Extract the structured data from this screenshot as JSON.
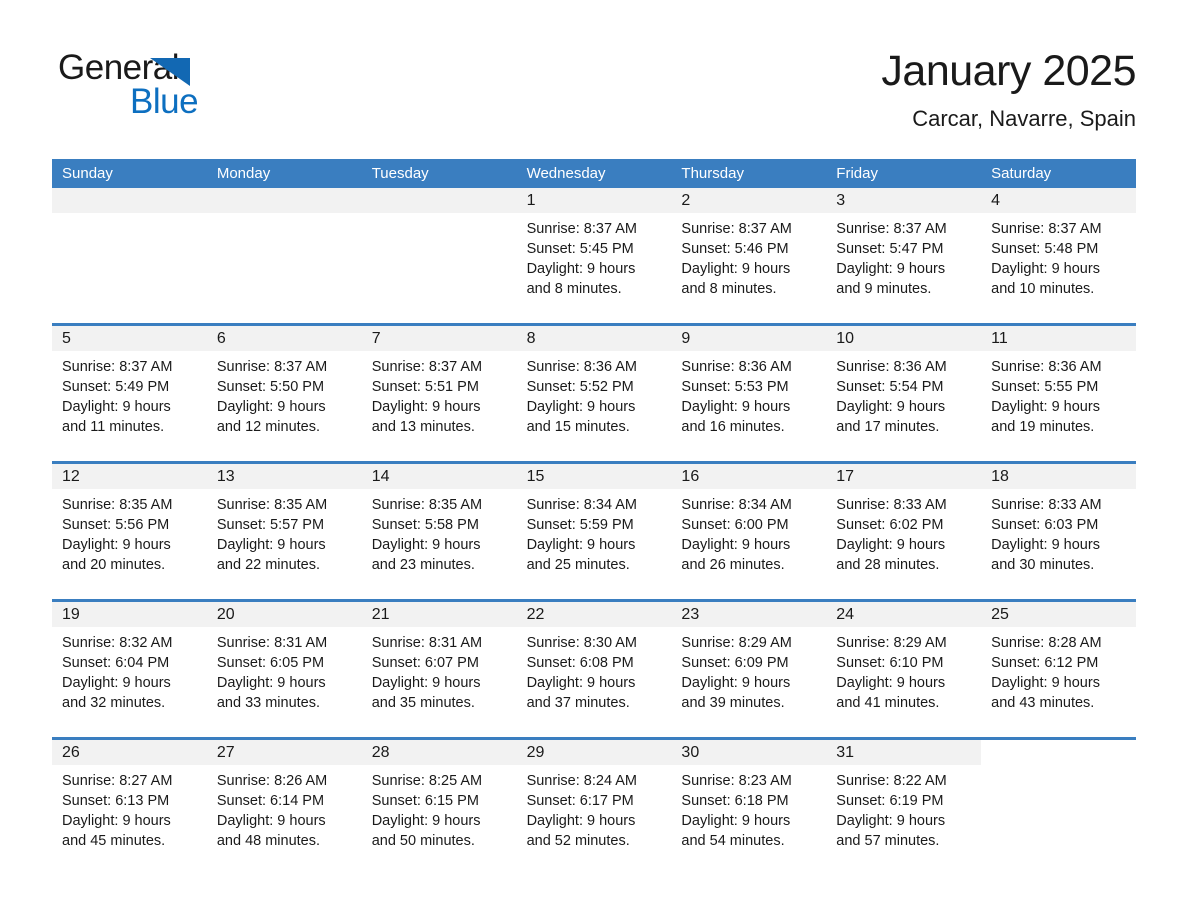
{
  "brand": {
    "name_part1": "General",
    "name_part2": "Blue",
    "accent_color": "#0d6fc0",
    "triangle_color": "#1268b3"
  },
  "header": {
    "title": "January 2025",
    "subtitle": "Carcar, Navarre, Spain"
  },
  "theme": {
    "header_row_bg": "#3a7ec0",
    "week_divider": "#3a7ec0",
    "day_band_bg": "#f2f2f2",
    "text_color": "#1a1a1a"
  },
  "weekdays": [
    "Sunday",
    "Monday",
    "Tuesday",
    "Wednesday",
    "Thursday",
    "Friday",
    "Saturday"
  ],
  "weeks": [
    [
      {
        "day": "",
        "l1": "",
        "l2": "",
        "l3": "",
        "l4": "",
        "empty": true
      },
      {
        "day": "",
        "l1": "",
        "l2": "",
        "l3": "",
        "l4": "",
        "empty": true
      },
      {
        "day": "",
        "l1": "",
        "l2": "",
        "l3": "",
        "l4": "",
        "empty": true
      },
      {
        "day": "1",
        "l1": "Sunrise: 8:37 AM",
        "l2": "Sunset: 5:45 PM",
        "l3": "Daylight: 9 hours",
        "l4": "and 8 minutes."
      },
      {
        "day": "2",
        "l1": "Sunrise: 8:37 AM",
        "l2": "Sunset: 5:46 PM",
        "l3": "Daylight: 9 hours",
        "l4": "and 8 minutes."
      },
      {
        "day": "3",
        "l1": "Sunrise: 8:37 AM",
        "l2": "Sunset: 5:47 PM",
        "l3": "Daylight: 9 hours",
        "l4": "and 9 minutes."
      },
      {
        "day": "4",
        "l1": "Sunrise: 8:37 AM",
        "l2": "Sunset: 5:48 PM",
        "l3": "Daylight: 9 hours",
        "l4": "and 10 minutes."
      }
    ],
    [
      {
        "day": "5",
        "l1": "Sunrise: 8:37 AM",
        "l2": "Sunset: 5:49 PM",
        "l3": "Daylight: 9 hours",
        "l4": "and 11 minutes."
      },
      {
        "day": "6",
        "l1": "Sunrise: 8:37 AM",
        "l2": "Sunset: 5:50 PM",
        "l3": "Daylight: 9 hours",
        "l4": "and 12 minutes."
      },
      {
        "day": "7",
        "l1": "Sunrise: 8:37 AM",
        "l2": "Sunset: 5:51 PM",
        "l3": "Daylight: 9 hours",
        "l4": "and 13 minutes."
      },
      {
        "day": "8",
        "l1": "Sunrise: 8:36 AM",
        "l2": "Sunset: 5:52 PM",
        "l3": "Daylight: 9 hours",
        "l4": "and 15 minutes."
      },
      {
        "day": "9",
        "l1": "Sunrise: 8:36 AM",
        "l2": "Sunset: 5:53 PM",
        "l3": "Daylight: 9 hours",
        "l4": "and 16 minutes."
      },
      {
        "day": "10",
        "l1": "Sunrise: 8:36 AM",
        "l2": "Sunset: 5:54 PM",
        "l3": "Daylight: 9 hours",
        "l4": "and 17 minutes."
      },
      {
        "day": "11",
        "l1": "Sunrise: 8:36 AM",
        "l2": "Sunset: 5:55 PM",
        "l3": "Daylight: 9 hours",
        "l4": "and 19 minutes."
      }
    ],
    [
      {
        "day": "12",
        "l1": "Sunrise: 8:35 AM",
        "l2": "Sunset: 5:56 PM",
        "l3": "Daylight: 9 hours",
        "l4": "and 20 minutes."
      },
      {
        "day": "13",
        "l1": "Sunrise: 8:35 AM",
        "l2": "Sunset: 5:57 PM",
        "l3": "Daylight: 9 hours",
        "l4": "and 22 minutes."
      },
      {
        "day": "14",
        "l1": "Sunrise: 8:35 AM",
        "l2": "Sunset: 5:58 PM",
        "l3": "Daylight: 9 hours",
        "l4": "and 23 minutes."
      },
      {
        "day": "15",
        "l1": "Sunrise: 8:34 AM",
        "l2": "Sunset: 5:59 PM",
        "l3": "Daylight: 9 hours",
        "l4": "and 25 minutes."
      },
      {
        "day": "16",
        "l1": "Sunrise: 8:34 AM",
        "l2": "Sunset: 6:00 PM",
        "l3": "Daylight: 9 hours",
        "l4": "and 26 minutes."
      },
      {
        "day": "17",
        "l1": "Sunrise: 8:33 AM",
        "l2": "Sunset: 6:02 PM",
        "l3": "Daylight: 9 hours",
        "l4": "and 28 minutes."
      },
      {
        "day": "18",
        "l1": "Sunrise: 8:33 AM",
        "l2": "Sunset: 6:03 PM",
        "l3": "Daylight: 9 hours",
        "l4": "and 30 minutes."
      }
    ],
    [
      {
        "day": "19",
        "l1": "Sunrise: 8:32 AM",
        "l2": "Sunset: 6:04 PM",
        "l3": "Daylight: 9 hours",
        "l4": "and 32 minutes."
      },
      {
        "day": "20",
        "l1": "Sunrise: 8:31 AM",
        "l2": "Sunset: 6:05 PM",
        "l3": "Daylight: 9 hours",
        "l4": "and 33 minutes."
      },
      {
        "day": "21",
        "l1": "Sunrise: 8:31 AM",
        "l2": "Sunset: 6:07 PM",
        "l3": "Daylight: 9 hours",
        "l4": "and 35 minutes."
      },
      {
        "day": "22",
        "l1": "Sunrise: 8:30 AM",
        "l2": "Sunset: 6:08 PM",
        "l3": "Daylight: 9 hours",
        "l4": "and 37 minutes."
      },
      {
        "day": "23",
        "l1": "Sunrise: 8:29 AM",
        "l2": "Sunset: 6:09 PM",
        "l3": "Daylight: 9 hours",
        "l4": "and 39 minutes."
      },
      {
        "day": "24",
        "l1": "Sunrise: 8:29 AM",
        "l2": "Sunset: 6:10 PM",
        "l3": "Daylight: 9 hours",
        "l4": "and 41 minutes."
      },
      {
        "day": "25",
        "l1": "Sunrise: 8:28 AM",
        "l2": "Sunset: 6:12 PM",
        "l3": "Daylight: 9 hours",
        "l4": "and 43 minutes."
      }
    ],
    [
      {
        "day": "26",
        "l1": "Sunrise: 8:27 AM",
        "l2": "Sunset: 6:13 PM",
        "l3": "Daylight: 9 hours",
        "l4": "and 45 minutes."
      },
      {
        "day": "27",
        "l1": "Sunrise: 8:26 AM",
        "l2": "Sunset: 6:14 PM",
        "l3": "Daylight: 9 hours",
        "l4": "and 48 minutes."
      },
      {
        "day": "28",
        "l1": "Sunrise: 8:25 AM",
        "l2": "Sunset: 6:15 PM",
        "l3": "Daylight: 9 hours",
        "l4": "and 50 minutes."
      },
      {
        "day": "29",
        "l1": "Sunrise: 8:24 AM",
        "l2": "Sunset: 6:17 PM",
        "l3": "Daylight: 9 hours",
        "l4": "and 52 minutes."
      },
      {
        "day": "30",
        "l1": "Sunrise: 8:23 AM",
        "l2": "Sunset: 6:18 PM",
        "l3": "Daylight: 9 hours",
        "l4": "and 54 minutes."
      },
      {
        "day": "31",
        "l1": "Sunrise: 8:22 AM",
        "l2": "Sunset: 6:19 PM",
        "l3": "Daylight: 9 hours",
        "l4": "and 57 minutes."
      },
      {
        "day": "",
        "l1": "",
        "l2": "",
        "l3": "",
        "l4": "",
        "empty": true,
        "noband": true
      }
    ]
  ]
}
